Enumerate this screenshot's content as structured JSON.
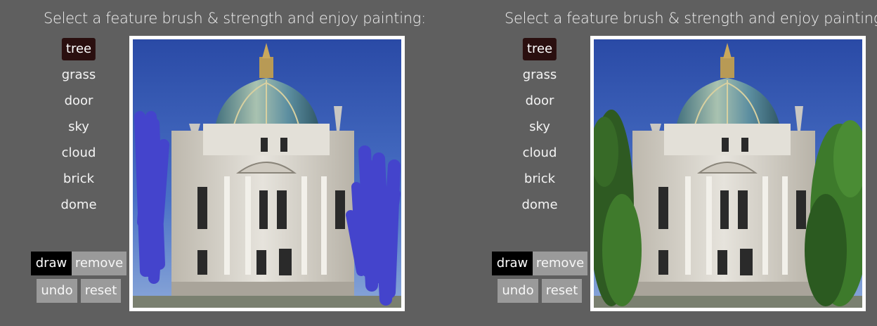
{
  "left_panel": {
    "title": "Select a feature brush & strength and enjoy painting:",
    "brushes": [
      {
        "label": "tree",
        "active": true
      },
      {
        "label": "grass",
        "active": false
      },
      {
        "label": "door",
        "active": false
      },
      {
        "label": "sky",
        "active": false
      },
      {
        "label": "cloud",
        "active": false
      },
      {
        "label": "brick",
        "active": false
      },
      {
        "label": "dome",
        "active": false
      }
    ],
    "buttons": {
      "draw": "draw",
      "remove": "remove",
      "undo": "undo",
      "reset": "reset"
    },
    "canvas": {
      "content": "building-with-painted-tree-strokes",
      "stroke_color": "#4444cc"
    }
  },
  "right_panel": {
    "title": "Select a feature brush & strength and enjoy painting:",
    "brushes": [
      {
        "label": "tree",
        "active": true
      },
      {
        "label": "grass",
        "active": false
      },
      {
        "label": "door",
        "active": false
      },
      {
        "label": "sky",
        "active": false
      },
      {
        "label": "cloud",
        "active": false
      },
      {
        "label": "brick",
        "active": false
      },
      {
        "label": "dome",
        "active": false
      }
    ],
    "buttons": {
      "draw": "draw",
      "remove": "remove",
      "undo": "undo",
      "reset": "reset"
    },
    "canvas": {
      "content": "building-with-generated-trees"
    }
  },
  "colors": {
    "background": "#5f5f5f",
    "active_brush": "#2a0f0f",
    "button_active": "#000000",
    "button_default": "#9a9a9a",
    "sky": "#2f55b0",
    "stone": "#d9d6cf",
    "dome": "#5e8a99",
    "tree": "#2e5a22"
  }
}
